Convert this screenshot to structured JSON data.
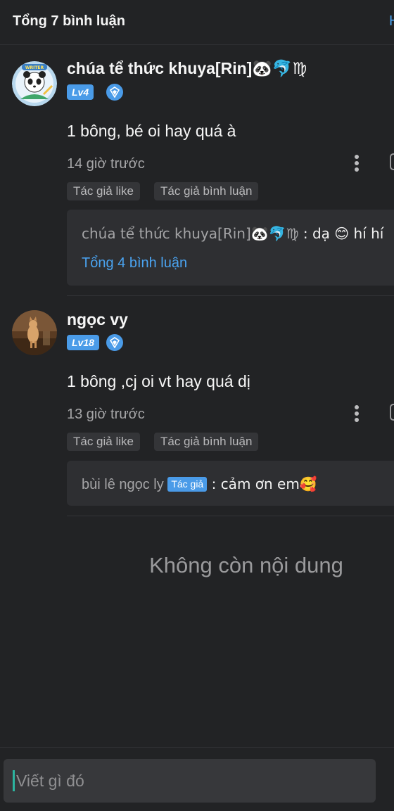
{
  "header": {
    "title": "Tổng 7 bình luận",
    "cut_text": "H"
  },
  "comments": [
    {
      "username": "chúa tể thức khuya[Rin]🐼🐬♍",
      "level": "Lv4",
      "avatar_badge": "WRITER",
      "text": "1 bông, bé oi hay quá à",
      "time": "14 giờ trước",
      "tags": [
        "Tác giả like",
        "Tác giả bình luận"
      ],
      "reply": {
        "name": "chúa tể thức khuya[Rin]🐼🐬♍",
        "text": " : dạ 😊 hí hí",
        "total": "Tổng 4 bình luận"
      }
    },
    {
      "username": "ngọc vy",
      "level": "Lv18",
      "text": "1 bông ,cj oi vt hay quá dị",
      "time": "13 giờ trước",
      "tags": [
        "Tác giả like",
        "Tác giả bình luận"
      ],
      "reply": {
        "name": "bùi lê ngọc ly",
        "badge": "Tác giả",
        "text": " : cảm ơn em🥰"
      }
    }
  ],
  "no_more": "Không còn nội dung",
  "input": {
    "placeholder": "Viết gì đó"
  },
  "colors": {
    "background": "#222325",
    "accent": "#4a9be8",
    "link": "#4aa3f0",
    "caret": "#2cb5a0"
  },
  "icons": [
    "shield-icon",
    "more-vertical-icon"
  ]
}
